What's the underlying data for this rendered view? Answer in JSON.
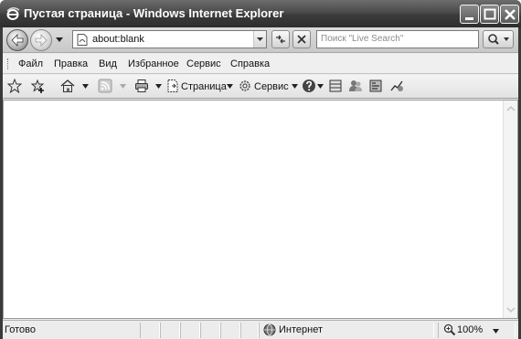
{
  "window": {
    "title": "Пустая страница - Windows Internet Explorer"
  },
  "address_bar": {
    "url": "about:blank"
  },
  "search": {
    "placeholder": "Поиск \"Live Search\""
  },
  "menu": {
    "items": [
      "Файл",
      "Правка",
      "Вид",
      "Избранное",
      "Сервис",
      "Справка"
    ]
  },
  "command_bar": {
    "page_label": "Страница",
    "tools_label": "Сервис"
  },
  "status_bar": {
    "status": "Готово",
    "zone": "Интернет",
    "zoom": "100%"
  },
  "icons": {
    "title": "ie-logo-icon",
    "back": "back-arrow-icon",
    "forward": "forward-arrow-icon",
    "page": "page-icon",
    "refresh": "refresh-icon",
    "stop": "stop-icon",
    "search": "magnifier-icon",
    "favorites": "star-icon",
    "add_favorites": "add-favorite-icon",
    "home": "home-icon",
    "feeds": "rss-icon",
    "print": "printer-icon",
    "help": "help-icon",
    "research": "research-icon",
    "messenger": "messenger-icon",
    "zone": "globe-icon",
    "zoom": "zoom-icon"
  }
}
